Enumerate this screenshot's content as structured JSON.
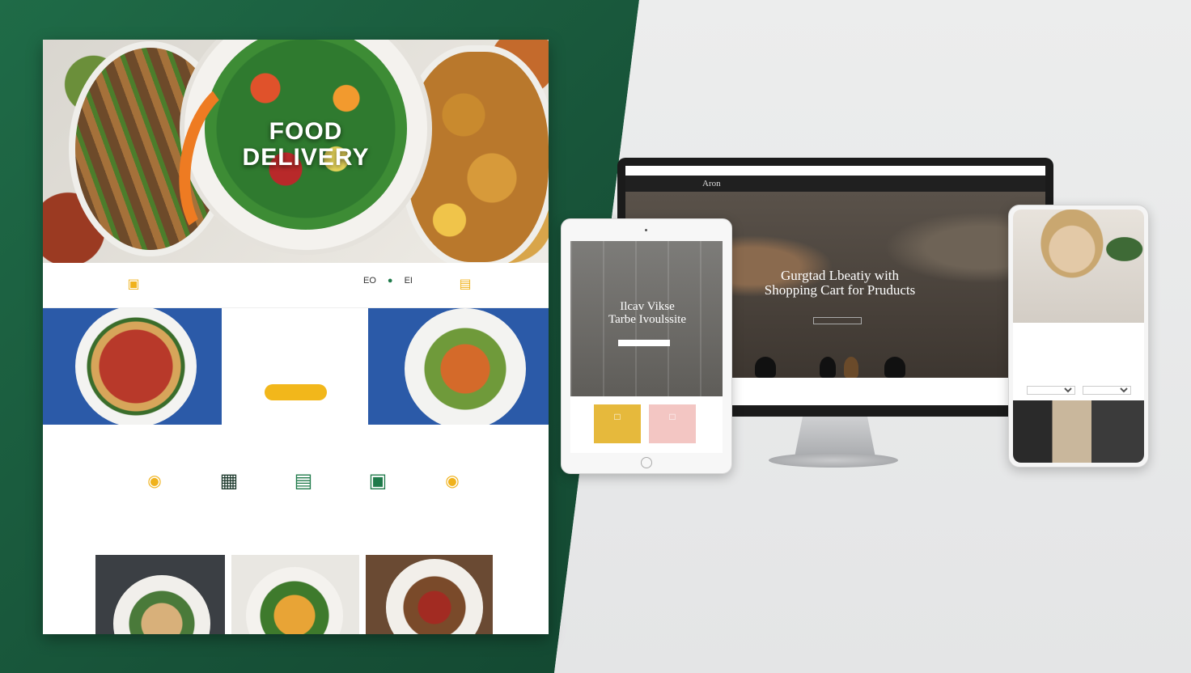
{
  "food_site": {
    "hero": {
      "title_line1": "FOOD",
      "title_line2": "DELIVERY",
      "subtitle": ""
    },
    "nav": {
      "links": [
        "",
        "",
        "",
        "",
        ""
      ],
      "tools": [
        "EO",
        "EI"
      ],
      "cart_icon": "basket-icon",
      "bag_icon": "bag-icon"
    },
    "promo": {
      "title": "",
      "description": "",
      "button_label": ""
    },
    "categories": {
      "heading": "",
      "items": [
        {
          "icon": "burger-icon",
          "label": ""
        },
        {
          "icon": "shopping-basket-icon",
          "label": ""
        },
        {
          "icon": "car-icon",
          "label": ""
        },
        {
          "icon": "cart-icon",
          "label": ""
        },
        {
          "icon": "delivery-icon",
          "label": ""
        }
      ]
    },
    "recommended_heading": ""
  },
  "desktop_site": {
    "brand": "Aron",
    "topbar": [
      "",
      "",
      ""
    ],
    "links": [
      "",
      "",
      "",
      "",
      ""
    ],
    "icons": "",
    "hero_title_line1": "Gurgtad Lbeatiy with",
    "hero_title_line2": "Shopping Cart for Pruducts",
    "hero_small": "",
    "cta_label": "",
    "product_labels": [
      "",
      "",
      "",
      ""
    ]
  },
  "tablet_site": {
    "hero_title_line1": "Ilcav Vikse",
    "hero_title_line2": "Tarbe Ivoulssite",
    "button_label": "",
    "cards": [
      {
        "label": ""
      },
      {
        "label": ""
      }
    ]
  },
  "phone_site": {
    "brand": "",
    "title": "",
    "subtitle": "",
    "select_left": "",
    "select_right": ""
  },
  "colors": {
    "green_bg": "#175238",
    "accent_orange": "#ee7b22",
    "accent_yellow": "#f2b71b",
    "accent_green": "#1f7a4a",
    "pink": "#f3c6c3"
  }
}
